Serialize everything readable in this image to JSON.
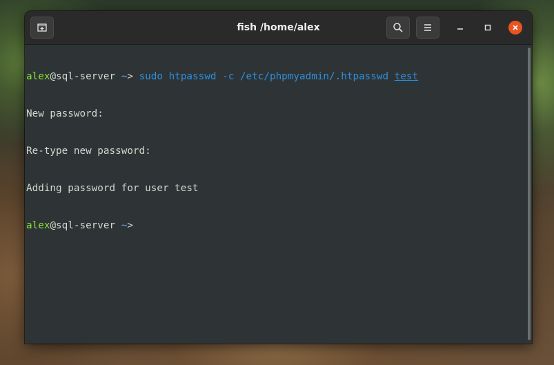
{
  "window": {
    "title": "fish /home/alex",
    "icons": {
      "new_tab": "new-tab-icon",
      "search": "search-icon",
      "menu": "hamburger-menu-icon",
      "minimize": "minimize-icon",
      "maximize": "maximize-icon",
      "close": "close-icon"
    },
    "colors": {
      "terminal_bg": "#2e3436",
      "titlebar_bg": "#2a2a2a",
      "close_button": "#e95420",
      "prompt_user": "#8ae234",
      "command": "#2f8fdd",
      "text": "#d3d7cf"
    }
  },
  "terminal": {
    "line1": {
      "user": "alex",
      "at_host": "@sql-server",
      "tilde": "~",
      "arrow": ">",
      "command": "sudo",
      "arg1": "htpasswd",
      "arg2": "-c",
      "arg3": "/etc/phpmyadmin/.htpasswd",
      "arg4": "test"
    },
    "line2": "New password:",
    "line3": "Re-type new password:",
    "line4": "Adding password for user test",
    "line5": {
      "user": "alex",
      "at_host": "@sql-server",
      "tilde": "~",
      "arrow": ">"
    }
  }
}
